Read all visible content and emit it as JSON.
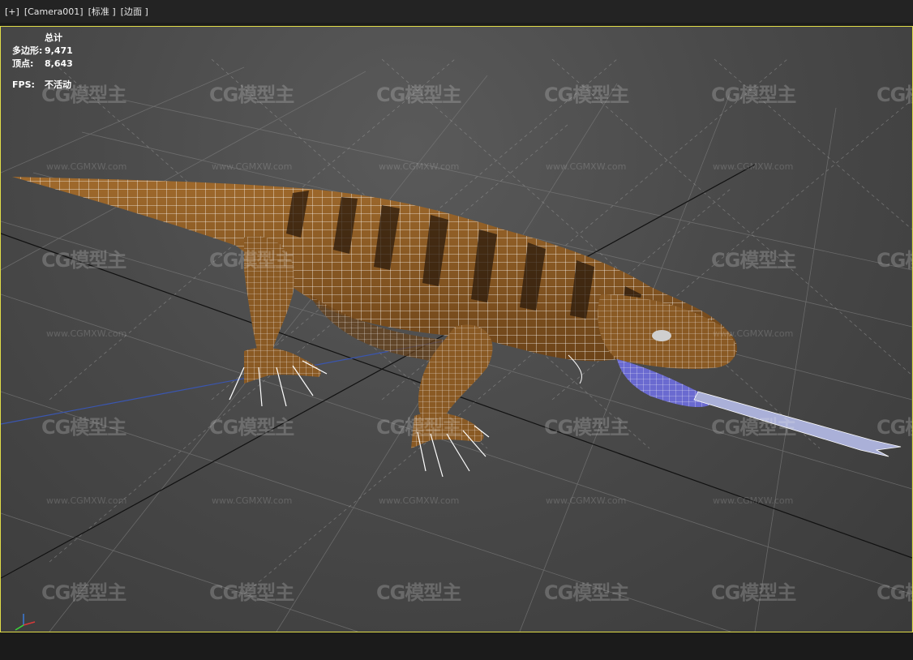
{
  "menubar": {
    "plus": "[+]",
    "camera": "[Camera001]",
    "shading": "[标准 ]",
    "edges": "[边面 ]"
  },
  "stats": {
    "title": "总计",
    "polys_label": "多边形:",
    "polys_value": "9,471",
    "verts_label": "顶点:",
    "verts_value": "8,643",
    "fps_label": "FPS:",
    "fps_value": "不活动"
  },
  "watermark": {
    "logo": "CG模型主",
    "url": "www.CGMXW.com"
  },
  "axis": {
    "z": "z",
    "x": "x",
    "y": "y"
  },
  "colors": {
    "border_active": "#e0dc48",
    "skin": "#8a5a24",
    "stripe": "#2a1a0c",
    "tongue": "#6a6ad0",
    "wire": "#ffffff"
  }
}
